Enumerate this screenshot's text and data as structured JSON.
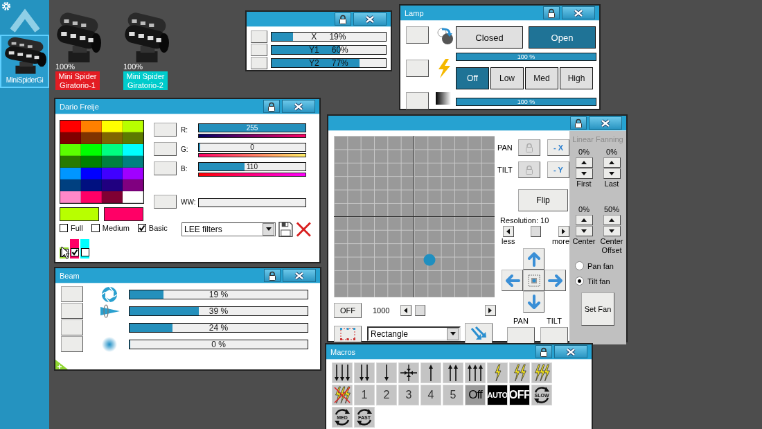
{
  "sidebar": {
    "fixtures": [
      {
        "label": "MiniSpiderGi",
        "selected": true
      }
    ]
  },
  "fixtures": [
    {
      "percent": "100%",
      "name": "Mini Spider Giratorio-1",
      "color": "#e31c23"
    },
    {
      "percent": "100%",
      "name": "Mini Spider Giratorio-2",
      "color": "#00cccc"
    }
  ],
  "position_window": {
    "sliders": [
      {
        "label": "X",
        "reading": "19%",
        "level": 0.19
      },
      {
        "label": "Y1",
        "reading": "60%",
        "level": 0.6
      },
      {
        "label": "Y2",
        "reading": "77%",
        "level": 0.77
      }
    ]
  },
  "lamp_window": {
    "title": "Lamp",
    "shutter": [
      {
        "label": "Closed",
        "selected": false
      },
      {
        "label": "Open",
        "selected": true
      }
    ],
    "dimmer": {
      "reading": "100 %",
      "level": 1
    },
    "modes": [
      {
        "label": "Off",
        "selected": true
      },
      {
        "label": "Low",
        "selected": false
      },
      {
        "label": "Med",
        "selected": false
      },
      {
        "label": "High",
        "selected": false
      }
    ],
    "fade": {
      "reading": "100 %",
      "level": 1
    }
  },
  "color_window": {
    "title": "Dario Freije",
    "palette": [
      {
        "color": "#ff0000"
      },
      {
        "color": "#ff8000"
      },
      {
        "color": "#ffff00"
      },
      {
        "color": "#b8ff00"
      },
      {
        "color": "#800000"
      },
      {
        "color": "#803300"
      },
      {
        "color": "#806600"
      },
      {
        "color": "#5c7a00"
      },
      {
        "color": "#5cff00"
      },
      {
        "color": "#00ff00"
      },
      {
        "color": "#00ff80"
      },
      {
        "color": "#00ffff"
      },
      {
        "color": "#287a00"
      },
      {
        "color": "#008000"
      },
      {
        "color": "#008040"
      },
      {
        "color": "#008080"
      },
      {
        "color": "#0096ff"
      },
      {
        "color": "#0000ff"
      },
      {
        "color": "#4000ff"
      },
      {
        "color": "#a000ff"
      },
      {
        "color": "#004080"
      },
      {
        "color": "#001080"
      },
      {
        "color": "#200080"
      },
      {
        "color": "#800080"
      },
      {
        "color": "#ff88c8"
      },
      {
        "color": "#ff0066"
      },
      {
        "color": "#800033"
      },
      {
        "color": "#ffffff"
      }
    ],
    "current_colors": [
      {
        "color": "#b8ff00"
      },
      {
        "color": "#ff0066"
      }
    ],
    "palette_sets": [
      {
        "label": "Full",
        "checked": false
      },
      {
        "label": "Medium",
        "checked": false
      },
      {
        "label": "Basic",
        "checked": true
      }
    ],
    "swatch_toggles": [
      {
        "color": "#99dd33",
        "checked": true
      },
      {
        "color": "#ff0066",
        "checked": true
      },
      {
        "color": "#00ffff",
        "checked": false
      }
    ],
    "channels": [
      {
        "label": "R:",
        "reading": "255",
        "level": 1
      },
      {
        "label": "G:",
        "reading": "0",
        "level": 0.01
      },
      {
        "label": "B:",
        "reading": "110",
        "level": 0.43
      },
      {
        "label": "WW:"
      }
    ],
    "filter": {
      "value": "LEE filters"
    }
  },
  "beam_window": {
    "title": "Beam",
    "rows": [
      {
        "kind": "iris",
        "reading": "19 %",
        "level": 0.19
      },
      {
        "kind": "zoom",
        "reading": "39 %",
        "level": 0.39
      },
      {
        "kind": "plain",
        "reading": "24 %",
        "level": 0.24
      },
      {
        "kind": "frost",
        "reading": "0 %",
        "level": 0.005
      }
    ]
  },
  "xy_window": {
    "effect": "OFF",
    "speed": "1000",
    "shape": {
      "value": "Rectangle"
    },
    "axes": [
      {
        "label": "PAN",
        "invert": "- X"
      },
      {
        "label": "TILT",
        "invert": "- Y"
      }
    ],
    "flip": "Flip",
    "resolution": "Resolution: 10",
    "less": "less",
    "more": "more",
    "outputs": [
      {
        "label": "PAN"
      },
      {
        "label": "TILT"
      }
    ],
    "fanning": {
      "title": "Linear Fanning",
      "spinners": [
        {
          "reading": "0%",
          "caption": "First"
        },
        {
          "reading": "0%",
          "caption": "Last"
        },
        {
          "reading": "0%",
          "caption": "Center"
        },
        {
          "reading": "50%",
          "caption": "Center Offset"
        }
      ],
      "modes": [
        {
          "label": "Pan fan",
          "selected": false
        },
        {
          "label": "Tilt fan",
          "selected": true
        }
      ],
      "apply": "Set Fan"
    }
  },
  "macros_window": {
    "title": "Macros",
    "items": [
      {
        "kind": "down3"
      },
      {
        "kind": "down2"
      },
      {
        "kind": "down1"
      },
      {
        "kind": "converge"
      },
      {
        "kind": "up1"
      },
      {
        "kind": "up2"
      },
      {
        "kind": "up3"
      },
      {
        "kind": "strobe1"
      },
      {
        "kind": "strobe2"
      },
      {
        "kind": "strobe3"
      },
      {
        "kind": "nostrobe"
      },
      {
        "kind": "number",
        "label": "1"
      },
      {
        "kind": "number",
        "label": "2"
      },
      {
        "kind": "number",
        "label": "3"
      },
      {
        "kind": "number",
        "label": "4"
      },
      {
        "kind": "number",
        "label": "5"
      },
      {
        "kind": "dim",
        "label": "Off"
      },
      {
        "kind": "black",
        "label": "AUTO"
      },
      {
        "kind": "black",
        "label": "OFF"
      },
      {
        "kind": "rotate",
        "label": "SLOW"
      },
      {
        "kind": "rotate",
        "label": "MED"
      },
      {
        "kind": "rotate",
        "label": "FAST"
      }
    ]
  }
}
